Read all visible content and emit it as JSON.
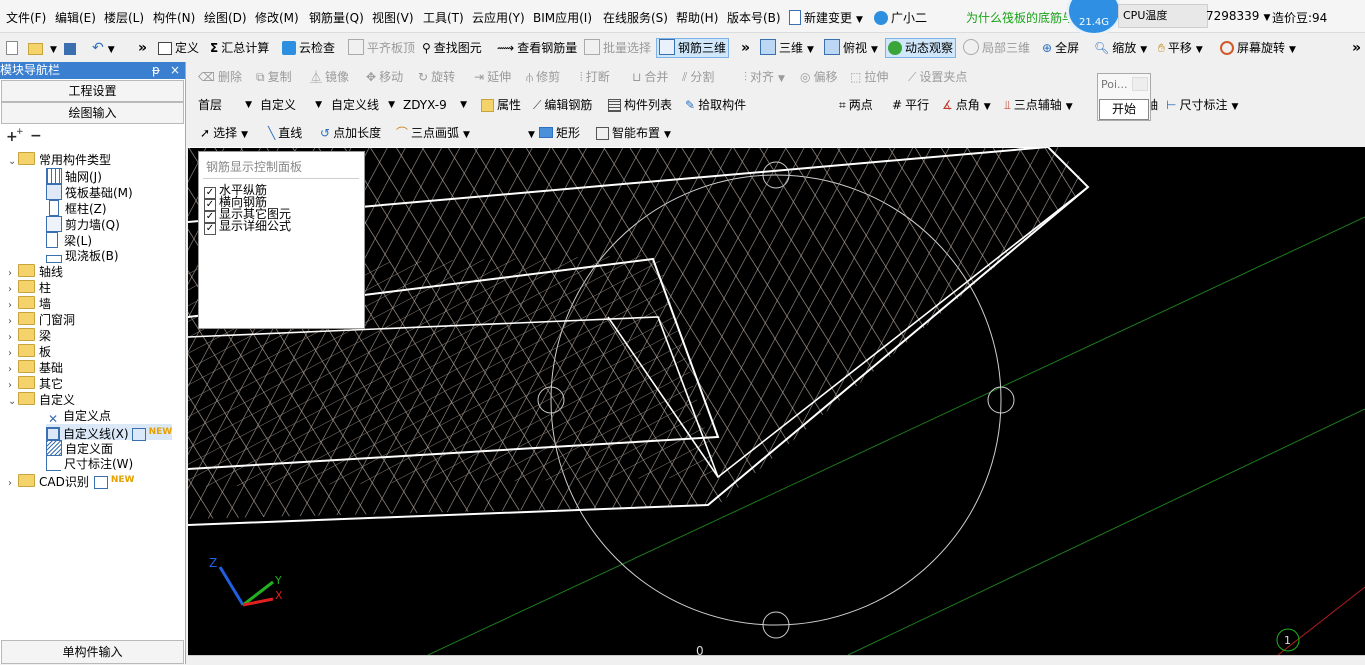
{
  "menu": {
    "items": [
      "文件(F)",
      "编辑(E)",
      "楼层(L)",
      "构件(N)",
      "绘图(D)",
      "修改(M)",
      "钢筋量(Q)",
      "视图(V)",
      "工具(T)",
      "云应用(Y)",
      "BIM应用(I)",
      "在线服务(S)",
      "帮助(H)",
      "版本号(B)"
    ],
    "new_change": "新建变更",
    "assistant": "广小二",
    "question": "为什么筏板的底筋与",
    "cpu_badge": "21.4G",
    "cpu_label": "CPU温度",
    "account_id": "7298339",
    "price_beans": "造价豆:94"
  },
  "toolbar1": {
    "define": "定义",
    "summary": "汇总计算",
    "cloud_check": "云检查",
    "flat_top": "平齐板顶",
    "find_element": "查找图元",
    "view_rebar": "查看钢筋量",
    "batch_select": "批量选择",
    "rebar_3d": "钢筋三维",
    "view_3d": "三维",
    "top_view": "俯视",
    "dynamic_view": "动态观察",
    "local_3d": "局部三维",
    "full_screen": "全屏",
    "zoom": "缩放",
    "pan": "平移",
    "screen_rotate": "屏幕旋转"
  },
  "toolbar2": {
    "delete": "删除",
    "copy": "复制",
    "mirror": "镜像",
    "move": "移动",
    "rotate": "旋转",
    "extend": "延伸",
    "trim": "修剪",
    "break": "打断",
    "merge": "合并",
    "split": "分割",
    "align": "对齐",
    "offset": "偏移",
    "stretch": "拉伸",
    "set_grip": "设置夹点"
  },
  "toolbar3": {
    "floor": "首层",
    "category": "自定义",
    "type": "自定义线",
    "element": "ZDYX-9",
    "properties": "属性",
    "edit_rebar": "编辑钢筋",
    "element_list": "构件列表",
    "pick_element": "拾取构件",
    "two_points": "两点",
    "parallel": "平行",
    "point_angle": "点角",
    "three_point_aux": "三点辅轴",
    "axis": "轴",
    "dimension": "尺寸标注"
  },
  "toolbar4": {
    "select": "选择",
    "line": "直线",
    "point_length": "点加长度",
    "three_point_arc": "三点画弧",
    "rectangle": "矩形",
    "smart_layout": "智能布置"
  },
  "popup": {
    "title": "Poi...",
    "start": "开始"
  },
  "left_panel": {
    "title": "模块导航栏",
    "pin": "ᵽ",
    "close": "×",
    "project_settings": "工程设置",
    "drawing_input": "绘图输入",
    "single_input": "单构件输入",
    "tree": {
      "common_types": "常用构件类型",
      "common_children": [
        "轴网(J)",
        "筏板基础(M)",
        "框柱(Z)",
        "剪力墙(Q)",
        "梁(L)",
        "现浇板(B)"
      ],
      "folders": [
        "轴线",
        "柱",
        "墙",
        "门窗洞",
        "梁",
        "板",
        "基础",
        "其它"
      ],
      "custom": "自定义",
      "custom_children": [
        "自定义点",
        "自定义线(X)",
        "自定义面",
        "尺寸标注(W)"
      ],
      "cad": "CAD识别",
      "new_badge": "NEW"
    }
  },
  "control_panel": {
    "title": "钢筋显示控制面板",
    "options": [
      {
        "label": "水平纵筋",
        "checked": true
      },
      {
        "label": "横向钢筋",
        "checked": true
      },
      {
        "label": "显示其它图元",
        "checked": true
      },
      {
        "label": "显示详细公式",
        "checked": true
      }
    ]
  },
  "viewport": {
    "axis_labels": [
      "Z",
      "Y",
      "X"
    ],
    "marker_label": "1",
    "bottom_mark": "0"
  }
}
